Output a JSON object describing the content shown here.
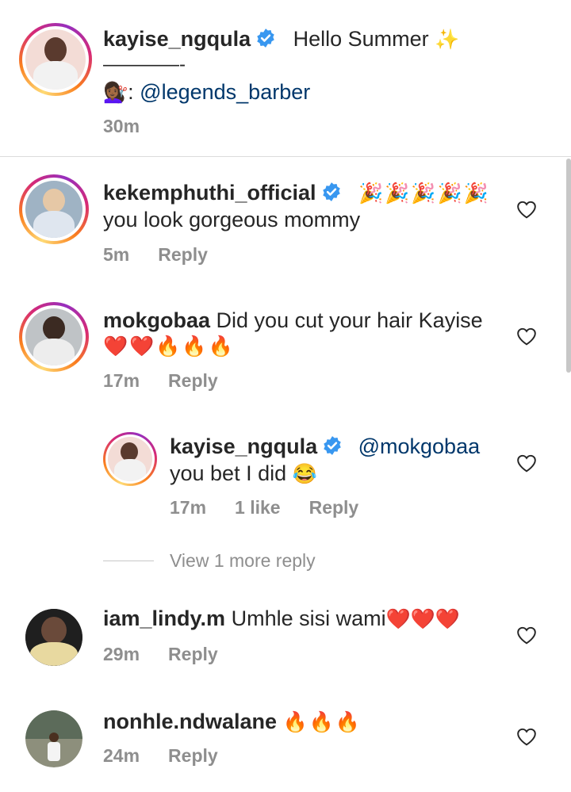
{
  "caption": {
    "username": "kayise_ngqula",
    "text": "Hello Summer",
    "sparkle": "✨",
    "separator": "————-",
    "credit_emoji": "💇🏾‍♀️",
    "credit_colon": ":",
    "credit_mention": "@legends_barber",
    "time": "30m"
  },
  "comments": [
    {
      "username": "kekemphuthi_official",
      "verified": true,
      "text_emoji": "🎉🎉🎉🎉🎉",
      "text_line2": "you look gorgeous mommy",
      "time": "5m",
      "reply": "Reply"
    },
    {
      "username": "mokgobaa",
      "text": "Did you cut your hair Kayise",
      "emoji_line": "❤️❤️🔥🔥🔥",
      "time": "17m",
      "reply": "Reply"
    },
    {
      "username": "kayise_ngqula",
      "verified": true,
      "mention": "@mokgobaa",
      "text_line2": "you bet I did",
      "emoji": "😂",
      "time": "17m",
      "likes": "1 like",
      "reply": "Reply"
    },
    {
      "username": "iam_lindy.m",
      "text": "Umhle sisi wami",
      "emoji": "❤️❤️❤️",
      "time": "29m",
      "reply": "Reply"
    },
    {
      "username": "nonhle.ndwalane",
      "emoji": "🔥🔥🔥",
      "time": "24m",
      "reply": "Reply"
    }
  ],
  "view_more": "View 1 more reply",
  "colors": {
    "text": "#262626",
    "meta": "#8e8e8e",
    "mention": "#00376b",
    "verified": "#3897f0"
  }
}
